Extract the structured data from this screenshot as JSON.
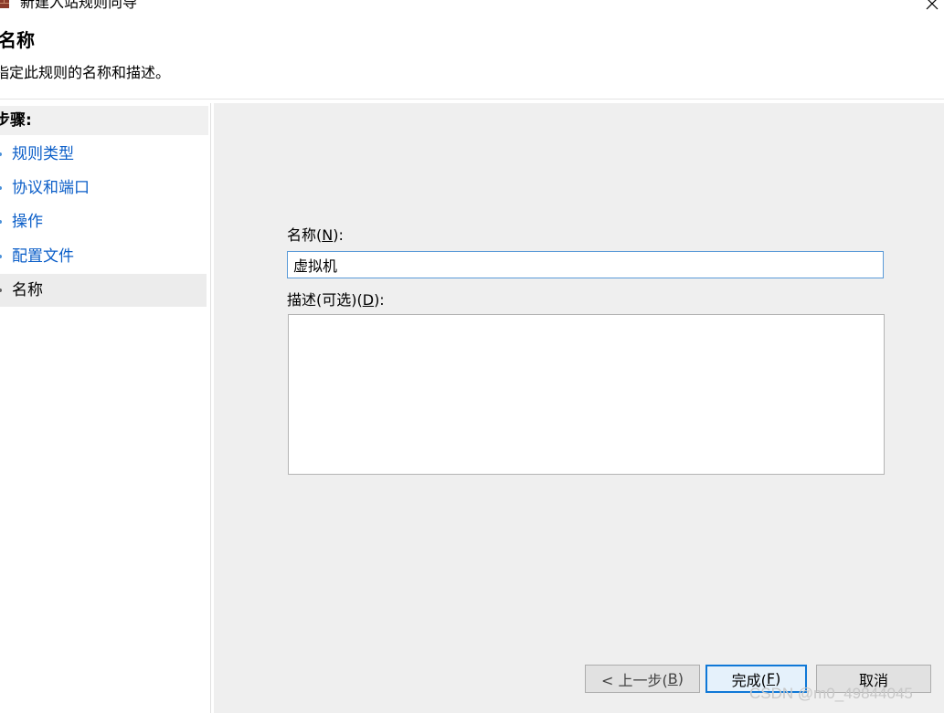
{
  "window": {
    "title": "新建入站规则向导",
    "icon": "firewall-icon",
    "close_icon": "close-icon"
  },
  "header": {
    "title": "名称",
    "subtitle": "指定此规则的名称和描述。"
  },
  "steps": {
    "heading": "步骤:",
    "items": [
      {
        "label": "规则类型"
      },
      {
        "label": "协议和端口"
      },
      {
        "label": "操作"
      },
      {
        "label": "配置文件"
      },
      {
        "label": "名称"
      }
    ],
    "current_label": "名称"
  },
  "form": {
    "name_label": "名称(",
    "name_key": "N",
    "name_label_end": "):",
    "name_value": "虚拟机",
    "desc_label": "描述(可选)(",
    "desc_key": "D",
    "desc_label_end": "):",
    "desc_value": ""
  },
  "buttons": {
    "back_label": "< 上一步(",
    "back_key": "B",
    "back_end": ")",
    "finish_label": "完成(",
    "finish_key": "F",
    "finish_end": ")",
    "cancel_label": "取消"
  },
  "watermark": "CSDN @m0_49844045",
  "colors": {
    "link": "#0b5ec8",
    "accent": "#0f78d7",
    "pane_bg": "#efefef"
  }
}
